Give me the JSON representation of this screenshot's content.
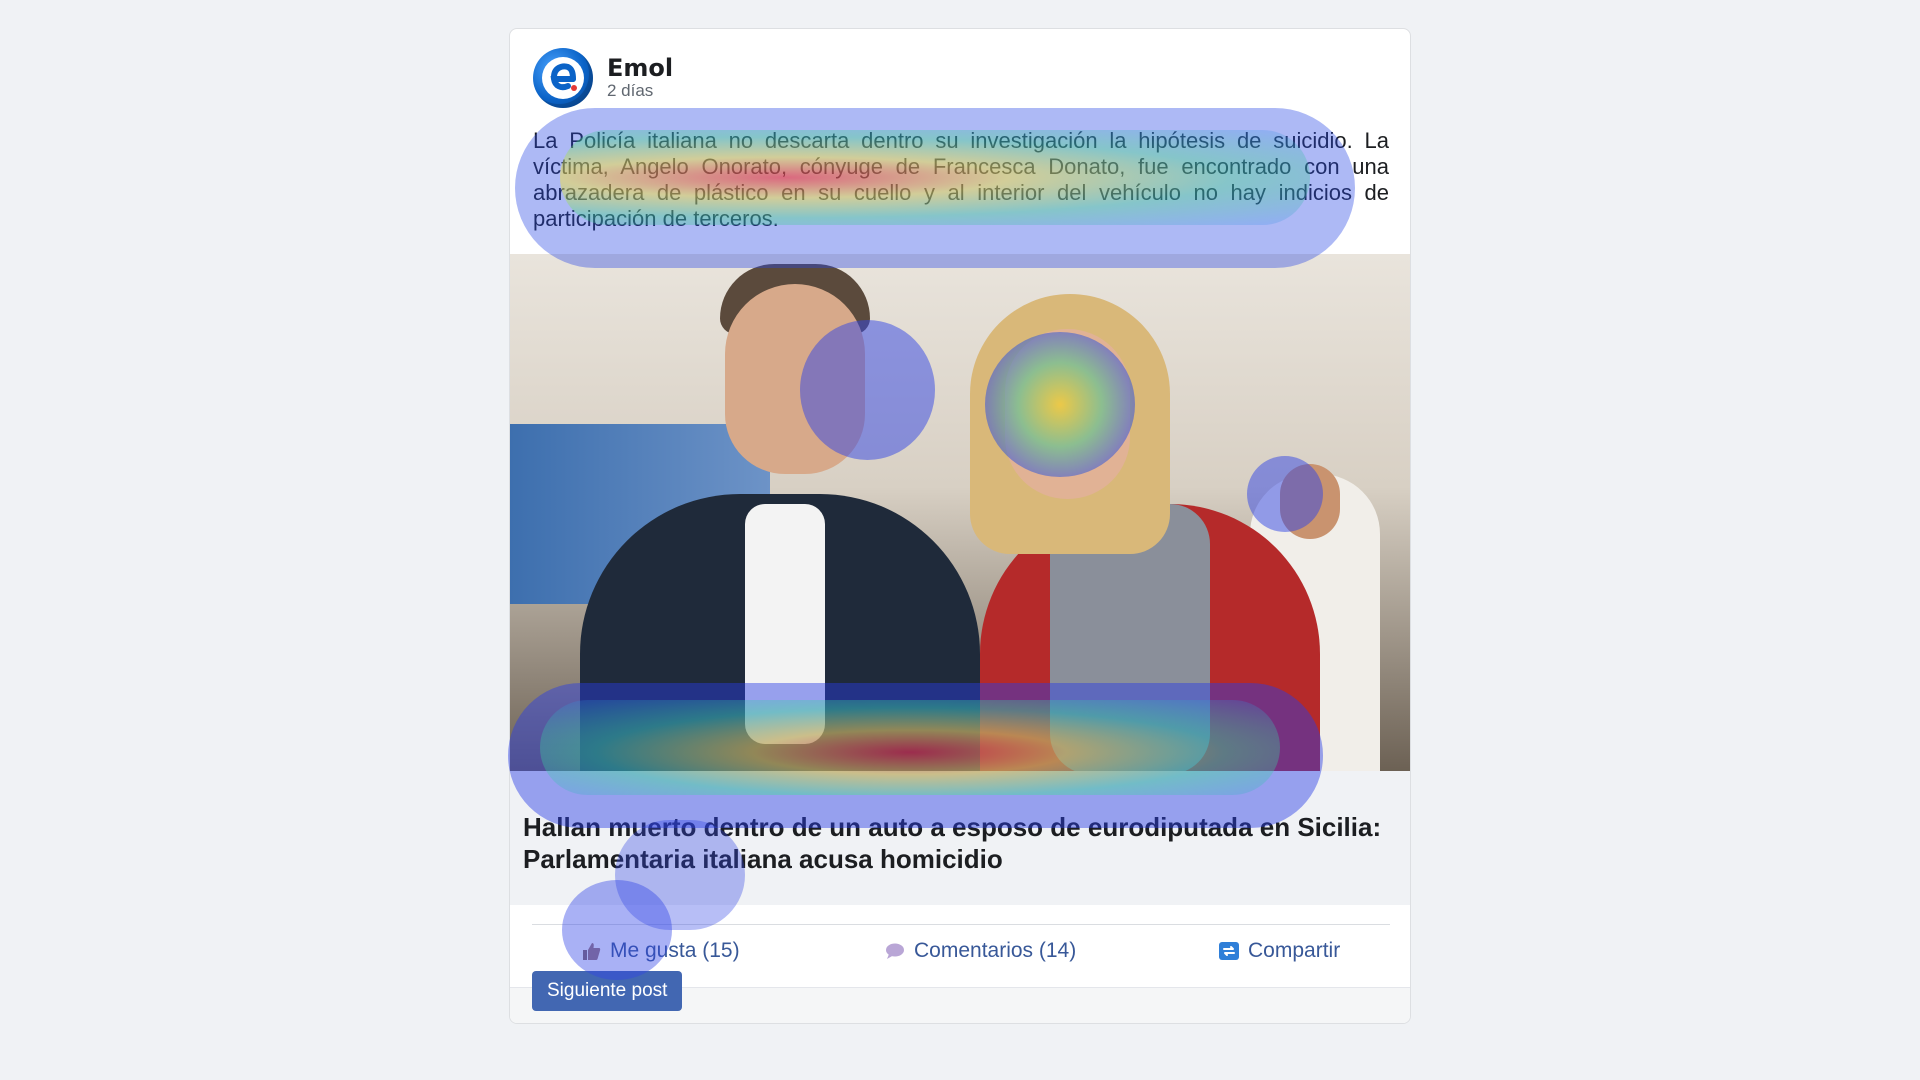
{
  "post": {
    "author": "Emol",
    "time": "2 días",
    "text": "La Policía italiana no descarta dentro su investigación la hipótesis de suicidio. La víctima, Angelo Onorato, cónyuge de Francesca Donato, fue encontrado con una abrazadera de plástico en su cuello y al interior del vehículo no hay indicios de participación de terceros.",
    "link_title": "Hallan muerto dentro de un auto a esposo de eurodiputada en Sicilia: Parlamentaria italiana acusa homicidio"
  },
  "actions": {
    "like": "Me gusta (15)",
    "comment": "Comentarios (14)",
    "share": "Compartir"
  },
  "footer": {
    "next": "Siguiente post"
  },
  "icons": {
    "avatar": "emol-logo-icon",
    "like": "thumbs-up-icon",
    "comment": "speech-bubble-icon",
    "share": "share-arrows-icon"
  },
  "colors": {
    "link": "#385898",
    "button": "#4267b2",
    "background": "#f0f2f5"
  }
}
